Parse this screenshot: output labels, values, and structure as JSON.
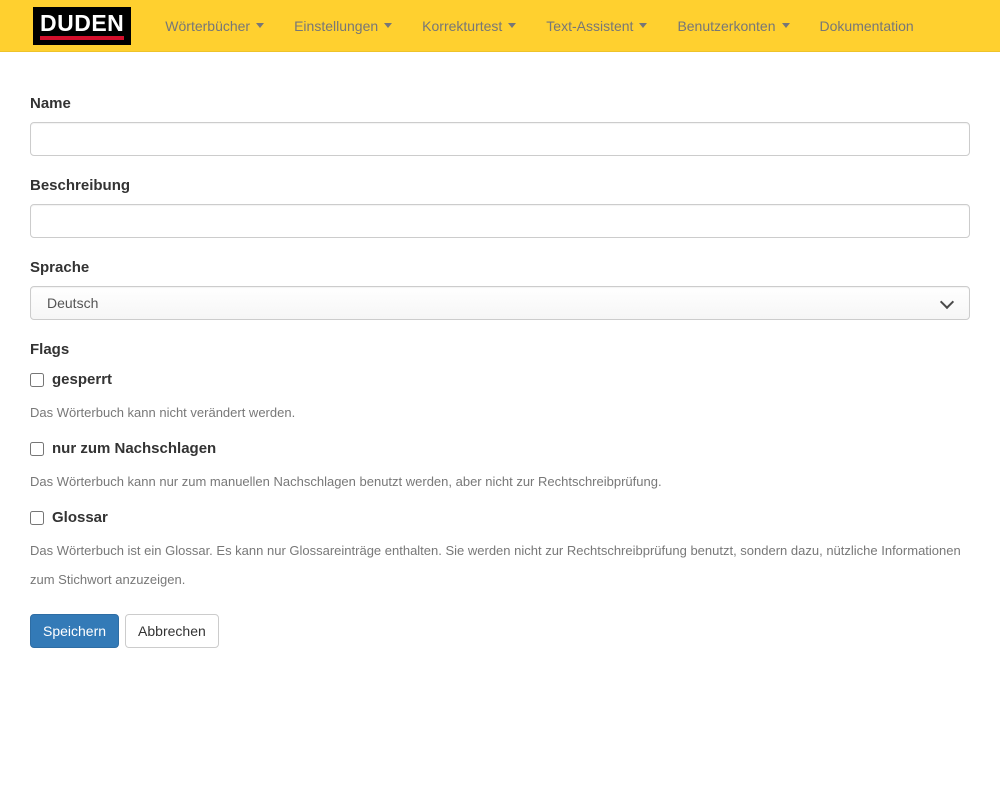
{
  "navbar": {
    "brand": "DUDEN",
    "items": [
      {
        "label": "Wörterbücher",
        "has_caret": true,
        "icon": "caret-down-icon"
      },
      {
        "label": "Einstellungen",
        "has_caret": true,
        "icon": "caret-down-icon"
      },
      {
        "label": "Korrekturtest",
        "has_caret": true,
        "icon": "caret-down-icon"
      },
      {
        "label": "Text-Assistent",
        "has_caret": true,
        "icon": "caret-down-icon"
      },
      {
        "label": "Benutzerkonten",
        "has_caret": true,
        "icon": "caret-down-icon"
      },
      {
        "label": "Dokumentation",
        "has_caret": false,
        "icon": ""
      }
    ],
    "colors": {
      "background": "#ffd02f",
      "brand_background": "#000000",
      "brand_text": "#ffffff",
      "brand_underline": "#d40f2c",
      "link_text": "#777777"
    }
  },
  "form": {
    "fields": [
      {
        "label": "Name",
        "type": "text",
        "value": "",
        "placeholder": ""
      },
      {
        "label": "Beschreibung",
        "type": "text",
        "value": "",
        "placeholder": ""
      },
      {
        "label": "Sprache",
        "type": "select",
        "value": "Deutsch"
      }
    ],
    "flags": {
      "label": "Flags",
      "options": [
        {
          "label": "gesperrt",
          "checked": false,
          "help": "Das Wörterbuch kann nicht verändert werden."
        },
        {
          "label": "nur zum Nachschlagen",
          "checked": false,
          "help": "Das Wörterbuch kann nur zum manuellen Nachschlagen benutzt werden, aber nicht zur Rechtschreibprüfung."
        },
        {
          "label": "Glossar",
          "checked": false,
          "help": "Das Wörterbuch ist ein Glossar. Es kann nur Glossareinträge enthalten. Sie werden nicht zur Rechtschreibprüfung benutzt, sondern dazu, nützliche Informationen zum Stichwort anzuzeigen."
        }
      ]
    },
    "buttons": {
      "save": "Speichern",
      "cancel": "Abbrechen"
    },
    "colors": {
      "primary_button": "#337ab7",
      "primary_button_border": "#2e6da4"
    }
  }
}
